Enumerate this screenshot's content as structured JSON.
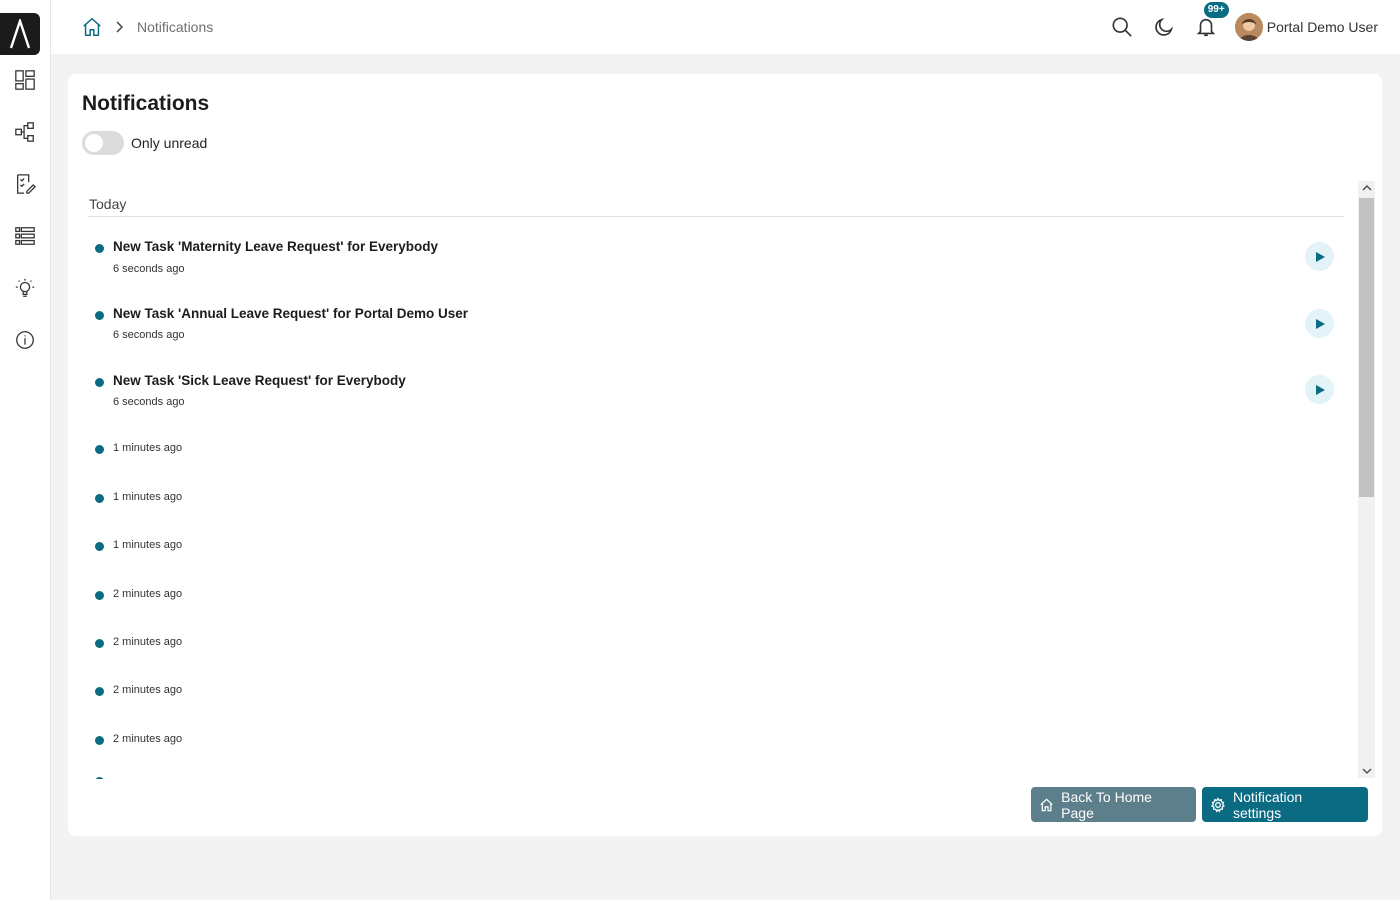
{
  "breadcrumb": {
    "current": "Notifications"
  },
  "topbar": {
    "notification_badge": "99+",
    "user_name": "Portal Demo User"
  },
  "sidebar": {
    "icons": [
      "dashboard-icon",
      "process-icon",
      "task-icon",
      "list-icon",
      "idea-icon",
      "info-icon"
    ]
  },
  "page": {
    "title": "Notifications",
    "toggle_label": "Only unread"
  },
  "notifications": {
    "group_label": "Today",
    "items": [
      {
        "title": "New Task 'Maternity Leave Request' for Everybody",
        "time": "6 seconds ago"
      },
      {
        "title": "New Task 'Annual Leave Request' for Portal Demo User",
        "time": "6 seconds ago"
      },
      {
        "title": "New Task 'Sick Leave Request' for Everybody",
        "time": "6 seconds ago"
      },
      {
        "title": "",
        "time": "1 minutes ago"
      },
      {
        "title": "",
        "time": "1 minutes ago"
      },
      {
        "title": "",
        "time": "1 minutes ago"
      },
      {
        "title": "",
        "time": "2 minutes ago"
      },
      {
        "title": "",
        "time": "2 minutes ago"
      },
      {
        "title": "",
        "time": "2 minutes ago"
      },
      {
        "title": "",
        "time": "2 minutes ago"
      }
    ]
  },
  "buttons": {
    "back_home": "Back To Home Page",
    "settings": "Notification settings"
  },
  "colors": {
    "accent": "#0b6b83",
    "secondary_button": "#5d7f8c",
    "play_bg": "#e3f3f7"
  }
}
